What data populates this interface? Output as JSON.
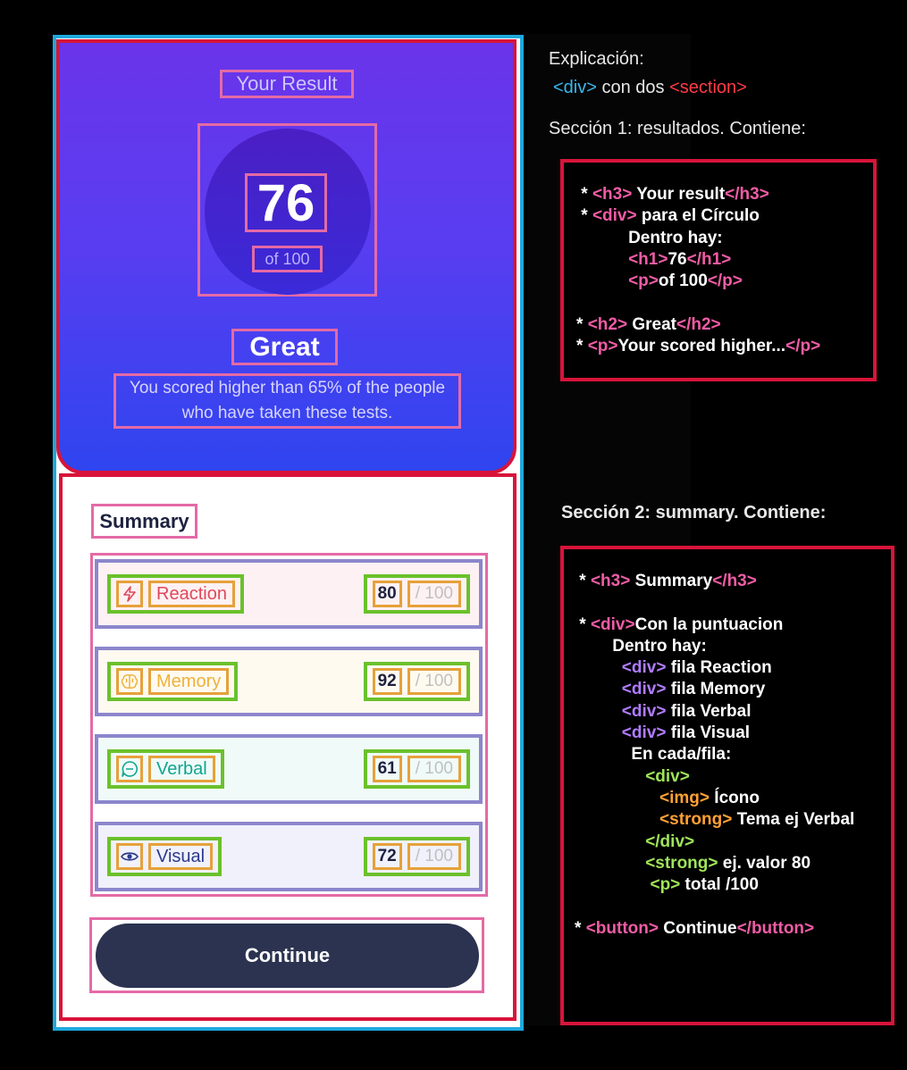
{
  "card": {
    "result": {
      "title": "Your Result",
      "score": "76",
      "out_of": "of 100",
      "rating": "Great",
      "description": "You scored higher than 65% of the people who have taken these tests."
    },
    "summary": {
      "title": "Summary",
      "rows": [
        {
          "icon": "lightning-icon",
          "label": "Reaction",
          "value": "80",
          "total": "/ 100",
          "color": "#e0485a"
        },
        {
          "icon": "brain-icon",
          "label": "Memory",
          "value": "92",
          "total": "/ 100",
          "color": "#f0b13a"
        },
        {
          "icon": "chat-icon",
          "label": "Verbal",
          "value": "61",
          "total": "/ 100",
          "color": "#0fa68f"
        },
        {
          "icon": "eye-icon",
          "label": "Visual",
          "value": "72",
          "total": "/ 100",
          "color": "#2c3a8c"
        }
      ]
    },
    "button": {
      "label": "Continue"
    }
  },
  "explanation": {
    "title": "Explicación:",
    "structure": {
      "tag1": "<div>",
      "text": "con dos",
      "tag2": "<section>"
    },
    "section1_heading": "Sección 1: resultados.  Contiene:",
    "section2_heading": "Sección 2: summary.   Contiene:"
  },
  "colors": {
    "gradient_top": "#6a34ea",
    "gradient_bottom": "#2f45ef",
    "button_bg": "#2b3350",
    "annotation_red": "#d8143a",
    "annotation_pink": "#e46aa6",
    "annotation_green": "#6bc12b",
    "annotation_orange": "#e6a13a",
    "outer_blue": "#1fa8dd"
  }
}
